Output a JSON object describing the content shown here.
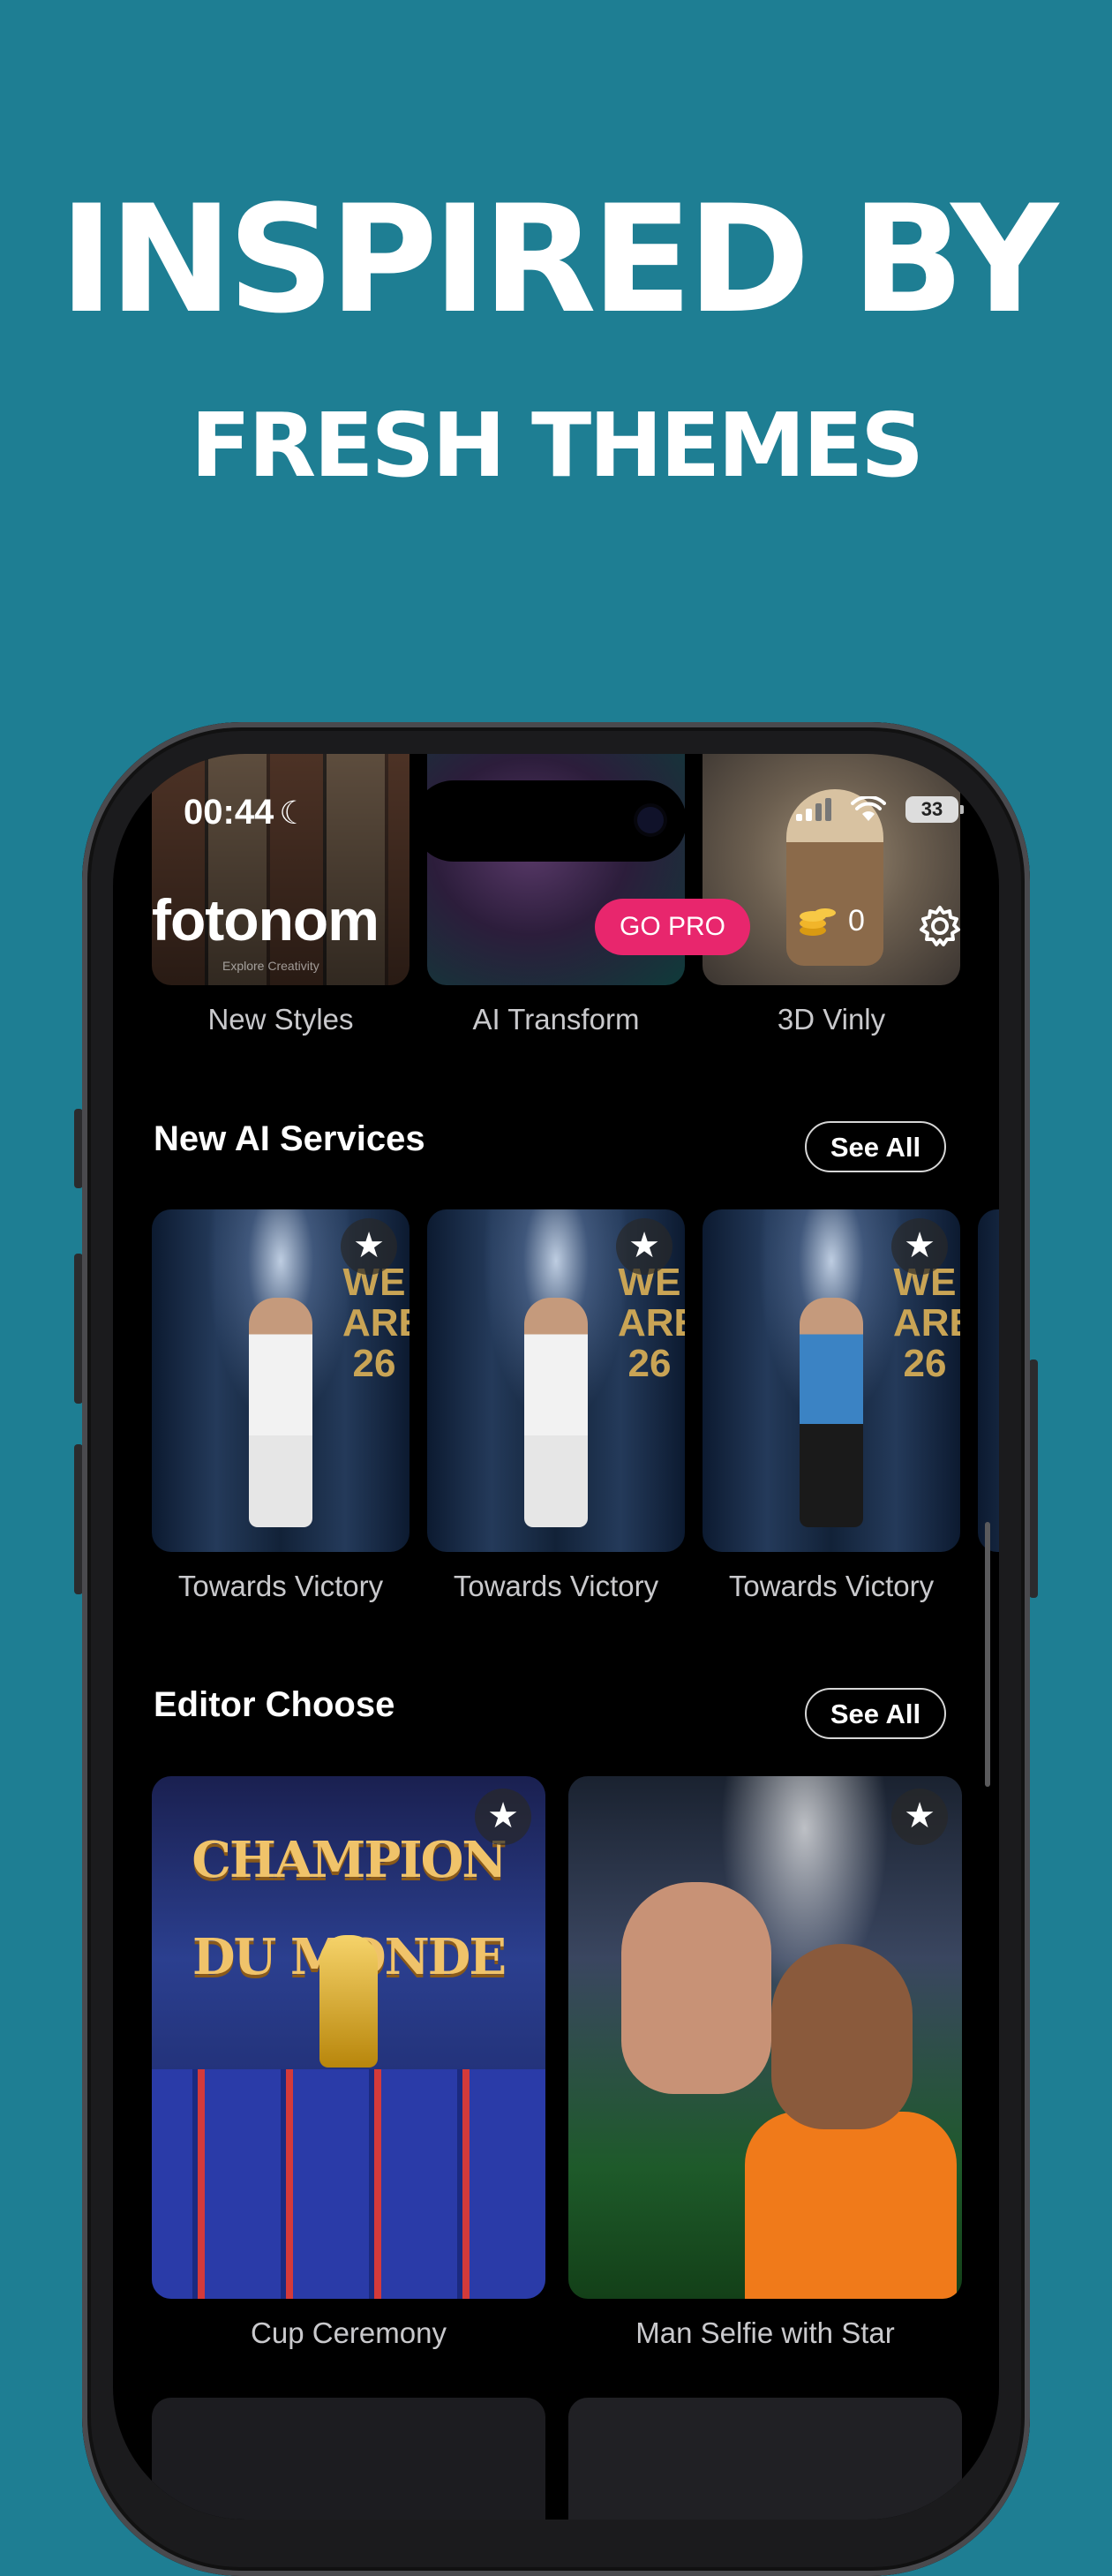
{
  "promo": {
    "headline": "INSPIRED BY",
    "subheadline": "FRESH THEMES"
  },
  "status_bar": {
    "time": "00:44",
    "battery": "33"
  },
  "header": {
    "logo": "fotonom",
    "tagline": "Explore Creativity",
    "go_pro_label": "GO PRO",
    "coins": "0"
  },
  "style_categories": [
    {
      "label": "New Styles"
    },
    {
      "label": "AI Transform"
    },
    {
      "label": "3D Vinly"
    }
  ],
  "new_ai_services": {
    "title": "New AI Services",
    "see_all_label": "See All",
    "items": [
      {
        "label": "Towards Victory",
        "wall_text": "WE ARE 26"
      },
      {
        "label": "Towards Victory",
        "wall_text": "WE ARE 26"
      },
      {
        "label": "Towards Victory",
        "wall_text": "WE ARE 26"
      }
    ]
  },
  "editor_choose": {
    "title": "Editor Choose",
    "see_all_label": "See All",
    "items": [
      {
        "label": "Cup Ceremony",
        "banner_text": "CHAMPION DU MONDE"
      },
      {
        "label": "Man Selfie with Star"
      }
    ]
  },
  "colors": {
    "background": "#1e7e93",
    "accent": "#e8266d"
  }
}
